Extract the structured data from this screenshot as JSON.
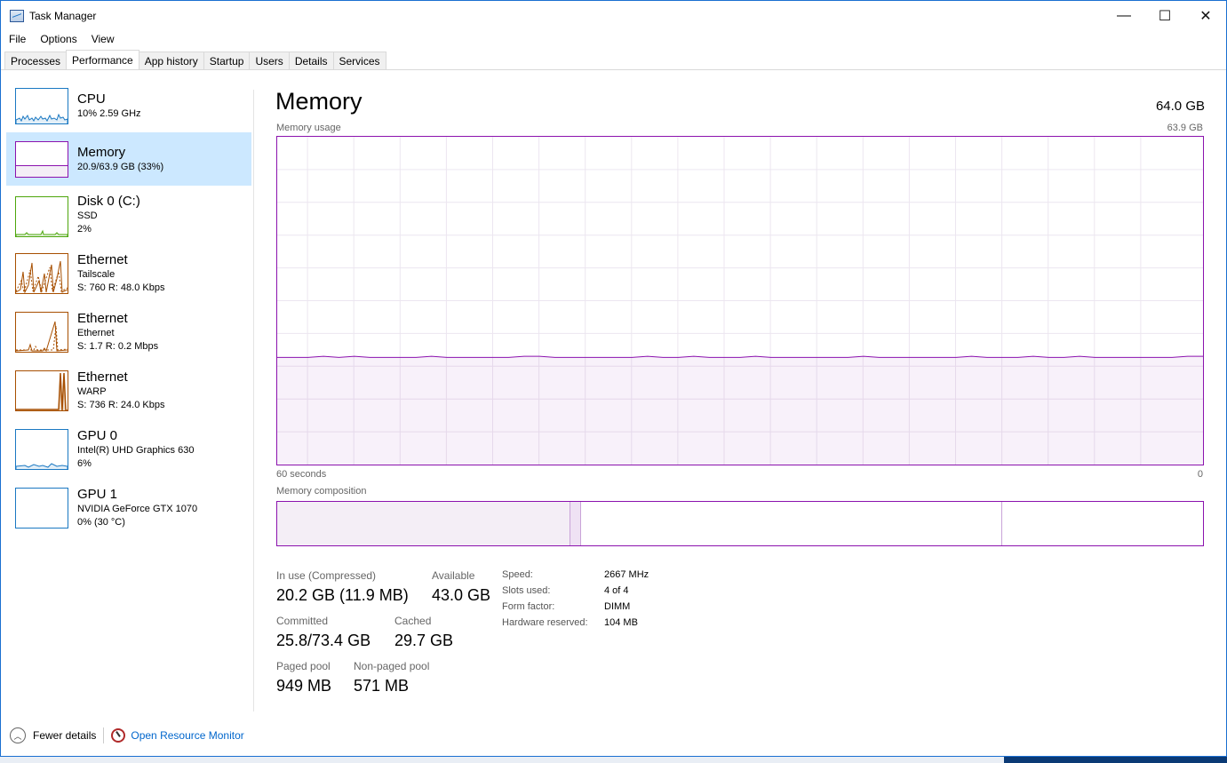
{
  "window": {
    "title": "Task Manager",
    "min": "—",
    "max": "☐",
    "close": "✕"
  },
  "menu": [
    "File",
    "Options",
    "View"
  ],
  "tabs": [
    "Processes",
    "Performance",
    "App history",
    "Startup",
    "Users",
    "Details",
    "Services"
  ],
  "active_tab": "Performance",
  "sidebar": [
    {
      "name": "CPU",
      "line1": "10% 2.59 GHz",
      "line2": "",
      "color": "#1a78c2"
    },
    {
      "name": "Memory",
      "line1": "20.9/63.9 GB (33%)",
      "line2": "",
      "color": "#8b12ae"
    },
    {
      "name": "Disk 0 (C:)",
      "line1": "SSD",
      "line2": "2%",
      "color": "#4da60c"
    },
    {
      "name": "Ethernet",
      "line1": "Tailscale",
      "line2": "S: 760  R: 48.0 Kbps",
      "color": "#a74f01"
    },
    {
      "name": "Ethernet",
      "line1": "Ethernet",
      "line2": "S: 1.7  R: 0.2 Mbps",
      "color": "#a74f01"
    },
    {
      "name": "Ethernet",
      "line1": "WARP",
      "line2": "S: 736  R: 24.0 Kbps",
      "color": "#a74f01"
    },
    {
      "name": "GPU 0",
      "line1": "Intel(R) UHD Graphics 630",
      "line2": "6%",
      "color": "#1a78c2"
    },
    {
      "name": "GPU 1",
      "line1": "NVIDIA GeForce GTX 1070",
      "line2": "0% (30 °C)",
      "color": "#1a78c2"
    }
  ],
  "main": {
    "title": "Memory",
    "total": "64.0 GB",
    "usage_label": "Memory usage",
    "usage_max": "63.9 GB",
    "x_left": "60 seconds",
    "x_right": "0",
    "composition_label": "Memory composition",
    "usage_fraction": 0.327,
    "composition": {
      "in_use": 0.317,
      "modified": 0.011,
      "standby": 0.455,
      "free": 0.217
    }
  },
  "stats": {
    "in_use_label": "In use (Compressed)",
    "in_use": "20.2 GB (11.9 MB)",
    "available_label": "Available",
    "available": "43.0 GB",
    "committed_label": "Committed",
    "committed": "25.8/73.4 GB",
    "cached_label": "Cached",
    "cached": "29.7 GB",
    "paged_label": "Paged pool",
    "paged": "949 MB",
    "nonpaged_label": "Non-paged pool",
    "nonpaged": "571 MB"
  },
  "specs": {
    "speed_label": "Speed:",
    "speed": "2667 MHz",
    "slots_label": "Slots used:",
    "slots": "4 of 4",
    "form_label": "Form factor:",
    "form": "DIMM",
    "hwres_label": "Hardware reserved:",
    "hwres": "104 MB"
  },
  "footer": {
    "fewer": "Fewer details",
    "monitor": "Open Resource Monitor"
  },
  "colors": {
    "memory": "#8b12ae",
    "selected_bg": "#cce8ff",
    "link": "#0066cc"
  }
}
